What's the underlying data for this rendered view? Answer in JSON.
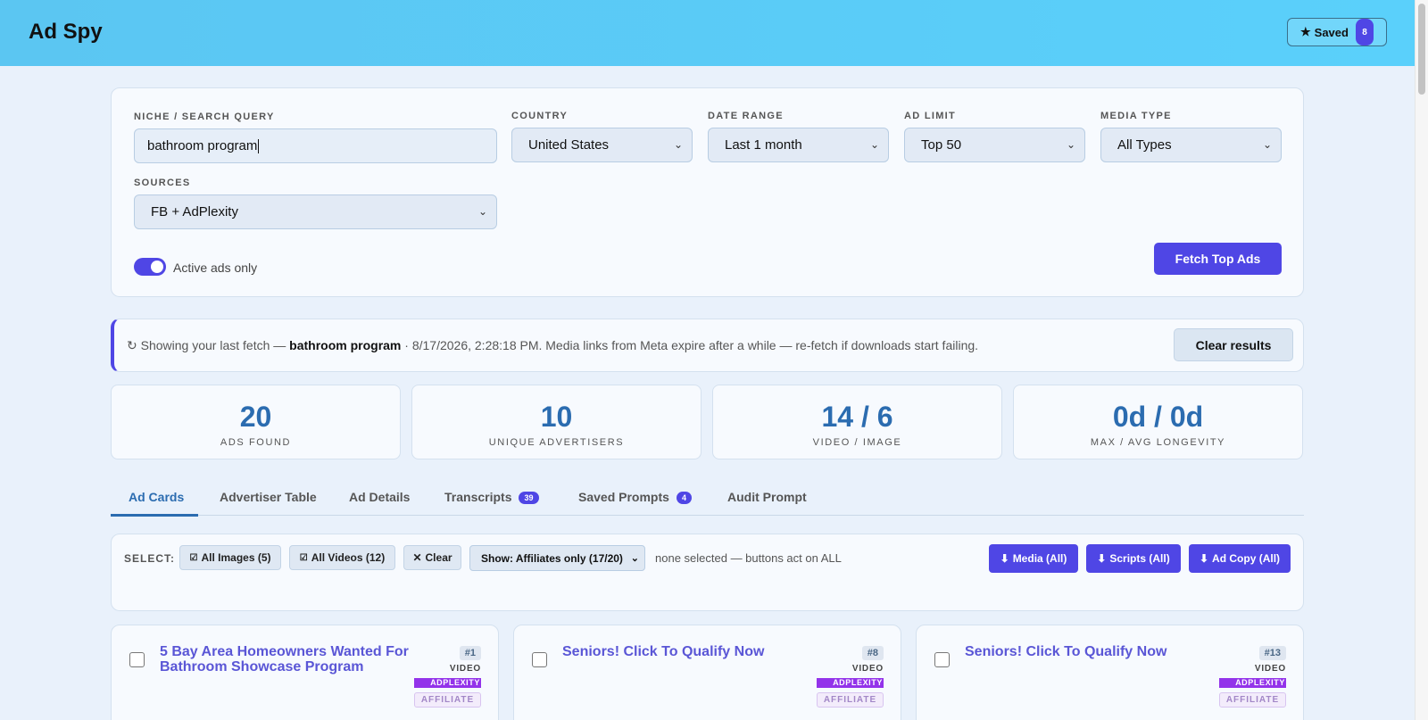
{
  "header": {
    "title": "Ad Spy",
    "saved_label": "Saved",
    "saved_count": "8"
  },
  "form": {
    "query_label": "NICHE / SEARCH QUERY",
    "query_value": "bathroom program",
    "country_label": "COUNTRY",
    "country_value": "United States",
    "date_label": "DATE RANGE",
    "date_value": "Last 1 month",
    "limit_label": "AD LIMIT",
    "limit_value": "Top 50",
    "media_label": "MEDIA TYPE",
    "media_value": "All Types",
    "sources_label": "SOURCES",
    "sources_value": "FB + AdPlexity",
    "active_only_label": "Active ads only",
    "active_only_on": true,
    "fetch_label": "Fetch Top Ads"
  },
  "info": {
    "prefix": "↻ Showing your last fetch — ",
    "query": "bathroom program",
    "suffix": " · 8/17/2026, 2:28:18 PM. Media links from Meta expire after a while — re-fetch if downloads start failing.",
    "clear_label": "Clear results"
  },
  "stats": [
    {
      "value": "20",
      "label": "ADS FOUND"
    },
    {
      "value": "10",
      "label": "UNIQUE ADVERTISERS"
    },
    {
      "value": "14 / 6",
      "label": "VIDEO / IMAGE"
    },
    {
      "value": "0d / 0d",
      "label": "MAX / AVG LONGEVITY"
    }
  ],
  "tabs": [
    {
      "label": "Ad Cards",
      "badge": ""
    },
    {
      "label": "Advertiser Table",
      "badge": ""
    },
    {
      "label": "Ad Details",
      "badge": ""
    },
    {
      "label": "Transcripts",
      "badge": "39"
    },
    {
      "label": "Saved Prompts",
      "badge": "4"
    },
    {
      "label": "Audit Prompt",
      "badge": ""
    }
  ],
  "selection": {
    "label": "SELECT:",
    "all_images": "All Images (5)",
    "all_videos": "All Videos (12)",
    "clear": "Clear",
    "show_value": "Show: Affiliates only (17/20)",
    "status": "none selected — buttons act on ALL",
    "media_btn": "Media (All)",
    "scripts_btn": "Scripts (All)",
    "copy_btn": "Ad Copy (All)"
  },
  "cards": [
    {
      "title": "5 Bay Area Homeowners Wanted For Bathroom Showcase Program",
      "rank": "#1",
      "type": "VIDEO",
      "source": "ADPLEXITY",
      "tag": "AFFILIATE"
    },
    {
      "title": "Seniors! Click To Qualify Now",
      "rank": "#8",
      "type": "VIDEO",
      "source": "ADPLEXITY",
      "tag": "AFFILIATE"
    },
    {
      "title": "Seniors! Click To Qualify Now",
      "rank": "#13",
      "type": "VIDEO",
      "source": "ADPLEXITY",
      "tag": "AFFILIATE"
    }
  ],
  "colors": {
    "header_bg": "#5ac9f6",
    "accent": "#4f46e5",
    "stat_value": "#2b6cb0",
    "source_badge": "#9333ea"
  }
}
